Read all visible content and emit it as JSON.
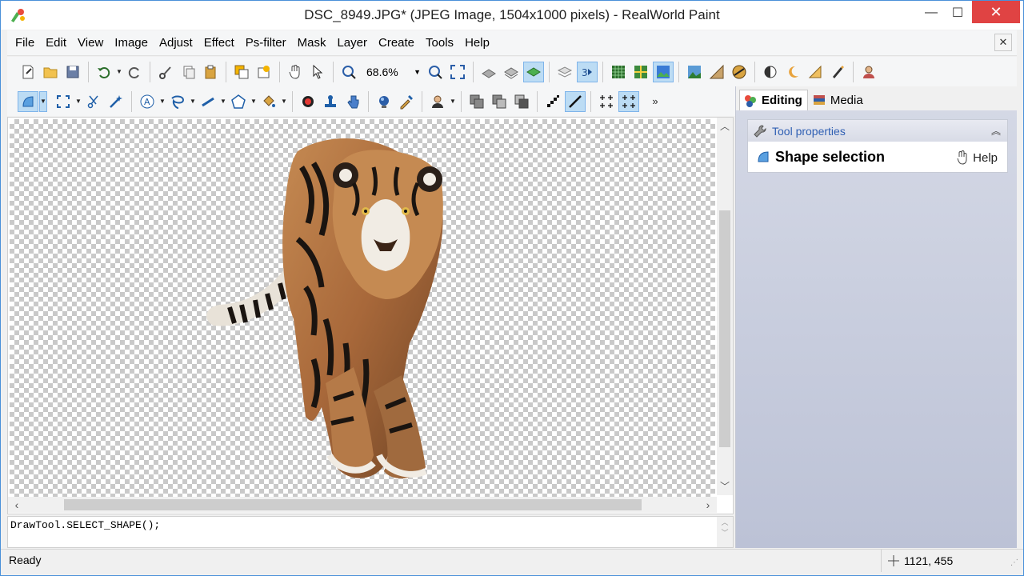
{
  "window": {
    "title": "DSC_8949.JPG* (JPEG Image, 1504x1000 pixels) - RealWorld Paint",
    "minimize": "—",
    "maximize": "☐",
    "close": "✕"
  },
  "menu": {
    "items": [
      "File",
      "Edit",
      "View",
      "Image",
      "Adjust",
      "Effect",
      "Ps-filter",
      "Mask",
      "Layer",
      "Create",
      "Tools",
      "Help"
    ],
    "mdi_close": "✕"
  },
  "toolbar": {
    "zoom_value": "68.6%",
    "zoom_arrow": "▼"
  },
  "script": {
    "code": "DrawTool.SELECT_SHAPE();"
  },
  "status": {
    "text": "Ready",
    "coords": "1121, 455"
  },
  "panel": {
    "tabs": [
      {
        "label": "Editing",
        "active": true
      },
      {
        "label": "Media",
        "active": false
      }
    ],
    "section_title": "Tool properties",
    "tool_name": "Shape selection",
    "help_label": "Help"
  },
  "colors": {
    "accent": "#2f5fb3",
    "close_button": "#e04343",
    "active_tool": "#bcdcf4"
  }
}
